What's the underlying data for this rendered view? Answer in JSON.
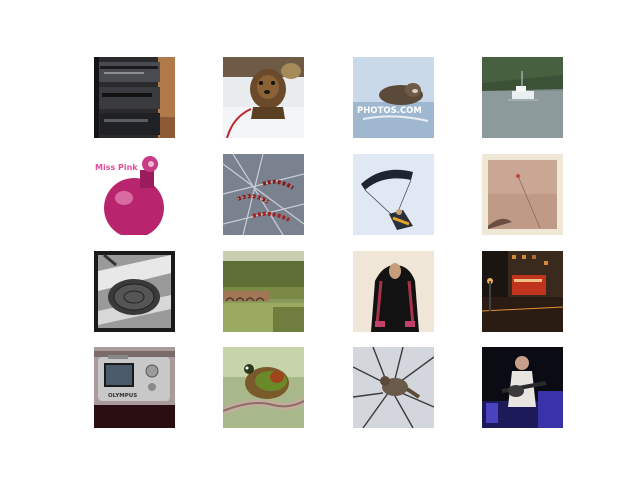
{
  "grid": {
    "rows": 4,
    "cols": 4,
    "tiles": [
      {
        "subject": "stereo-equipment-stack"
      },
      {
        "subject": "terrier-puppy-on-leash"
      },
      {
        "subject": "sea-otter-in-water",
        "watermark": "PHOTOS.COM"
      },
      {
        "subject": "motorboat-on-lake"
      },
      {
        "subject": "perfume-bottle",
        "text": "Miss Pink"
      },
      {
        "subject": "beaded-dog-collars-on-wire"
      },
      {
        "subject": "skydiver-with-parafoil"
      },
      {
        "subject": "faded-polaroid-sky"
      },
      {
        "subject": "manhole-cover-black-and-white"
      },
      {
        "subject": "stone-viaduct-landscape"
      },
      {
        "subject": "woman-in-black-abaya"
      },
      {
        "subject": "city-street-at-night"
      },
      {
        "subject": "compact-digital-camera",
        "text": "OLYMPUS"
      },
      {
        "subject": "hummingbird-on-branch"
      },
      {
        "subject": "bird-in-bare-tree"
      },
      {
        "subject": "guitarist-on-stage"
      }
    ]
  }
}
